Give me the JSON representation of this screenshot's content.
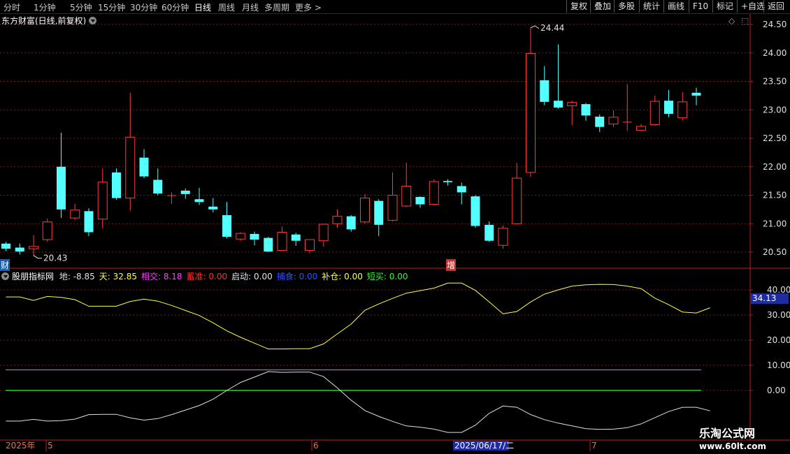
{
  "toolbar": {
    "tabs": [
      "分时",
      "1分钟",
      "5分钟",
      "15分钟",
      "30分钟",
      "60分钟",
      "日线",
      "周线",
      "月线",
      "多周期",
      "更多 >"
    ],
    "active_tab": "日线",
    "right_buttons": [
      "复权",
      "叠加",
      "多股",
      "统计",
      "画线",
      "F10",
      "标记",
      "+自选",
      "返回"
    ]
  },
  "chart_title": "东方财富(日线,前复权)",
  "markers": {
    "cai": "财",
    "zeng": "增"
  },
  "indicator": {
    "name": "股朋指标网",
    "fields": [
      {
        "label": "地:",
        "value": "-8.85",
        "color": "#e0e0e0"
      },
      {
        "label": "天:",
        "value": "32.85",
        "color": "#ffff40"
      },
      {
        "label": "相交:",
        "value": "8.18",
        "color": "#ff40ff"
      },
      {
        "label": "蓄准:",
        "value": "0.00",
        "color": "#ff3030"
      },
      {
        "label": "启动:",
        "value": "0.00",
        "color": "#e0e0e0"
      },
      {
        "label": "捕食:",
        "value": "0.00",
        "color": "#3050ff"
      },
      {
        "label": "补仓:",
        "value": "0.00",
        "color": "#ffff40"
      },
      {
        "label": "短买:",
        "value": "0.00",
        "color": "#30ff30"
      }
    ],
    "current_tag": "34.13"
  },
  "annotations": {
    "high": "24.44",
    "low": "20.43"
  },
  "watermark": {
    "name": "乐淘公式网",
    "url": "www.60lt.com"
  },
  "date_axis": {
    "year": "2025年",
    "months": [
      "5",
      "6",
      "7"
    ],
    "cursor_date": "2025/06/17/二"
  },
  "colors": {
    "up": "#ff3b3b",
    "down": "#54ffff",
    "grid": "#7a1a1a",
    "axis": "#b22222"
  },
  "chart_data": [
    {
      "type": "candlestick",
      "title": "东方财富(日线,前复权)",
      "y_ticks": [
        "24.50",
        "24.00",
        "23.50",
        "23.00",
        "22.50",
        "22.00",
        "21.50",
        "21.00",
        "20.50"
      ],
      "ylim": [
        20.3,
        24.6
      ],
      "candles": [
        {
          "o": 20.65,
          "c": 20.56,
          "h": 20.68,
          "l": 20.52
        },
        {
          "o": 20.58,
          "c": 20.51,
          "h": 20.65,
          "l": 20.46
        },
        {
          "o": 20.56,
          "c": 20.6,
          "h": 20.8,
          "l": 20.43
        },
        {
          "o": 20.72,
          "c": 21.03,
          "h": 21.09,
          "l": 20.68
        },
        {
          "o": 22.0,
          "c": 21.25,
          "h": 22.6,
          "l": 21.1
        },
        {
          "o": 21.1,
          "c": 21.24,
          "h": 21.35,
          "l": 21.06
        },
        {
          "o": 21.22,
          "c": 20.85,
          "h": 21.27,
          "l": 20.78
        },
        {
          "o": 21.08,
          "c": 21.73,
          "h": 21.97,
          "l": 20.92
        },
        {
          "o": 21.9,
          "c": 21.45,
          "h": 21.97,
          "l": 21.42
        },
        {
          "o": 21.45,
          "c": 22.52,
          "h": 23.3,
          "l": 21.23
        },
        {
          "o": 22.16,
          "c": 21.83,
          "h": 22.31,
          "l": 21.8
        },
        {
          "o": 21.77,
          "c": 21.53,
          "h": 21.97,
          "l": 21.5
        },
        {
          "o": 21.5,
          "c": 21.5,
          "h": 21.55,
          "l": 21.35
        },
        {
          "o": 21.58,
          "c": 21.52,
          "h": 21.62,
          "l": 21.44
        },
        {
          "o": 21.43,
          "c": 21.38,
          "h": 21.63,
          "l": 21.33
        },
        {
          "o": 21.3,
          "c": 21.25,
          "h": 21.45,
          "l": 21.2
        },
        {
          "o": 21.15,
          "c": 20.77,
          "h": 21.38,
          "l": 20.74
        },
        {
          "o": 20.73,
          "c": 20.83,
          "h": 20.85,
          "l": 20.7
        },
        {
          "o": 20.82,
          "c": 20.72,
          "h": 20.86,
          "l": 20.62
        },
        {
          "o": 20.75,
          "c": 20.51,
          "h": 20.77,
          "l": 20.5
        },
        {
          "o": 20.53,
          "c": 20.85,
          "h": 20.95,
          "l": 20.52
        },
        {
          "o": 20.81,
          "c": 20.7,
          "h": 20.84,
          "l": 20.61
        },
        {
          "o": 20.53,
          "c": 20.72,
          "h": 20.72,
          "l": 20.48
        },
        {
          "o": 20.7,
          "c": 20.99,
          "h": 21.0,
          "l": 20.6
        },
        {
          "o": 21.0,
          "c": 21.13,
          "h": 21.25,
          "l": 20.93
        },
        {
          "o": 21.13,
          "c": 20.9,
          "h": 21.15,
          "l": 20.86
        },
        {
          "o": 21.03,
          "c": 21.45,
          "h": 21.52,
          "l": 21.0
        },
        {
          "o": 21.4,
          "c": 20.98,
          "h": 21.43,
          "l": 20.78
        },
        {
          "o": 21.06,
          "c": 21.5,
          "h": 21.9,
          "l": 21.04
        },
        {
          "o": 21.31,
          "c": 21.66,
          "h": 22.07,
          "l": 21.29
        },
        {
          "o": 21.47,
          "c": 21.34,
          "h": 21.48,
          "l": 21.28
        },
        {
          "o": 21.34,
          "c": 21.74,
          "h": 21.78,
          "l": 21.33
        },
        {
          "o": 21.75,
          "c": 21.73,
          "h": 21.78,
          "l": 21.67
        },
        {
          "o": 21.66,
          "c": 21.55,
          "h": 21.72,
          "l": 21.34
        },
        {
          "o": 21.48,
          "c": 20.96,
          "h": 21.5,
          "l": 20.93
        },
        {
          "o": 20.98,
          "c": 20.7,
          "h": 21.04,
          "l": 20.68
        },
        {
          "o": 20.62,
          "c": 20.92,
          "h": 20.97,
          "l": 20.56
        },
        {
          "o": 21.0,
          "c": 21.8,
          "h": 22.07,
          "l": 20.99
        },
        {
          "o": 21.9,
          "c": 23.99,
          "h": 24.44,
          "l": 21.82
        },
        {
          "o": 23.52,
          "c": 23.14,
          "h": 23.77,
          "l": 23.08
        },
        {
          "o": 23.16,
          "c": 23.04,
          "h": 24.15,
          "l": 23.02
        },
        {
          "o": 23.07,
          "c": 23.13,
          "h": 23.16,
          "l": 22.73
        },
        {
          "o": 23.1,
          "c": 22.9,
          "h": 23.12,
          "l": 22.81
        },
        {
          "o": 22.88,
          "c": 22.7,
          "h": 22.92,
          "l": 22.61
        },
        {
          "o": 22.75,
          "c": 22.87,
          "h": 22.99,
          "l": 22.7
        },
        {
          "o": 22.79,
          "c": 22.79,
          "h": 23.45,
          "l": 22.63
        },
        {
          "o": 22.64,
          "c": 22.71,
          "h": 22.75,
          "l": 22.63
        },
        {
          "o": 22.74,
          "c": 23.15,
          "h": 23.25,
          "l": 22.72
        },
        {
          "o": 23.16,
          "c": 22.93,
          "h": 23.35,
          "l": 22.87
        },
        {
          "o": 22.86,
          "c": 23.14,
          "h": 23.31,
          "l": 22.81
        },
        {
          "o": 23.3,
          "c": 23.25,
          "h": 23.39,
          "l": 23.08
        }
      ]
    },
    {
      "type": "line",
      "title": "股朋指标网",
      "y_ticks": [
        "40.00",
        "30.00",
        "20.00",
        "10.00",
        "0.00"
      ],
      "ylim": [
        -17,
        46
      ],
      "reference_lines": [
        {
          "value": 8.18,
          "color": "#ff40ff"
        },
        {
          "value": 0.0,
          "color": "#30ff30"
        }
      ],
      "series": [
        {
          "name": "天",
          "color": "#ffff40",
          "values": [
            37.2,
            37.2,
            35.8,
            37.4,
            37.0,
            36.1,
            33.5,
            33.5,
            33.5,
            35.4,
            36.3,
            35.5,
            33.8,
            31.8,
            29.8,
            26.9,
            23.7,
            21.1,
            18.8,
            16.5,
            16.5,
            16.6,
            16.6,
            18.5,
            22.5,
            26.4,
            31.9,
            34.4,
            36.6,
            38.7,
            39.7,
            40.7,
            42.7,
            42.7,
            39.8,
            35.2,
            30.5,
            31.4,
            35.2,
            38.3,
            40.0,
            41.5,
            42.0,
            42.2,
            42.1,
            41.5,
            40.5,
            36.7,
            34.1,
            31.2,
            30.8,
            32.9
          ]
        },
        {
          "name": "地",
          "color": "#e0e0e0",
          "values": [
            -12.2,
            -12.2,
            -11.5,
            -12.2,
            -12.0,
            -11.4,
            -9.6,
            -9.5,
            -9.5,
            -10.9,
            -11.8,
            -11.2,
            -9.6,
            -7.8,
            -6.0,
            -3.5,
            0.0,
            3.2,
            5.3,
            7.5,
            7.2,
            7.3,
            7.3,
            5.5,
            1.0,
            -3.9,
            -8.0,
            -10.3,
            -12.3,
            -14.1,
            -14.6,
            -15.4,
            -16.7,
            -16.7,
            -13.8,
            -9.1,
            -6.2,
            -6.7,
            -9.6,
            -11.6,
            -13.0,
            -14.1,
            -15.2,
            -15.5,
            -15.4,
            -14.8,
            -13.3,
            -10.8,
            -8.4,
            -6.7,
            -6.7,
            -8.1
          ]
        }
      ]
    }
  ]
}
